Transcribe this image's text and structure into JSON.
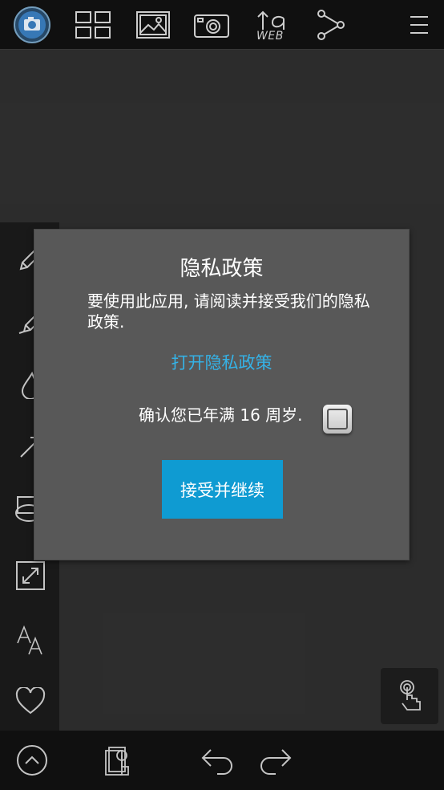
{
  "toolbar": {
    "web_label": "WEB",
    "icons": [
      "app-logo-camera-icon",
      "grid-icon",
      "gallery-icon",
      "camera-icon",
      "web-text-icon",
      "share-icon",
      "menu-icon"
    ]
  },
  "sidebar": {
    "tools": [
      "pencil-icon",
      "highlighter-icon",
      "drop-icon",
      "arrow-icon",
      "shape-icon",
      "resize-icon",
      "text-icon",
      "heart-icon"
    ]
  },
  "bottombar": {
    "icons": [
      "expand-up-icon",
      "touch-layers-icon",
      "undo-icon",
      "redo-icon"
    ]
  },
  "dialog": {
    "title": "隐私政策",
    "body": "要使用此应用, 请阅读并接受我们的隐私政策.",
    "link": "打开隐私政策",
    "age_confirm": "确认您已年满 16 周岁.",
    "accept_label": "接受并继续"
  },
  "colors": {
    "accent": "#0f9bd2",
    "link": "#35b2e6",
    "dialog_bg": "#585858",
    "canvas_bg": "#2f2f2f"
  }
}
